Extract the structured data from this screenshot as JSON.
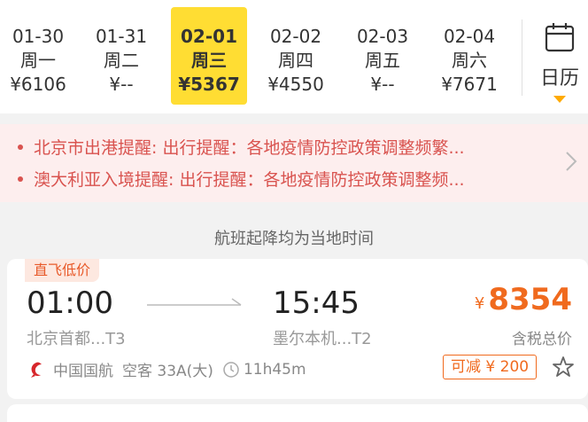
{
  "dates": [
    {
      "date": "01-30",
      "weekday": "周一",
      "price": "¥6106",
      "selected": false
    },
    {
      "date": "01-31",
      "weekday": "周二",
      "price": "¥--",
      "selected": false
    },
    {
      "date": "02-01",
      "weekday": "周三",
      "price": "¥5367",
      "selected": true
    },
    {
      "date": "02-02",
      "weekday": "周四",
      "price": "¥4550",
      "selected": false
    },
    {
      "date": "02-03",
      "weekday": "周五",
      "price": "¥--",
      "selected": false
    },
    {
      "date": "02-04",
      "weekday": "周六",
      "price": "¥7671",
      "selected": false
    }
  ],
  "calendar": {
    "label": "日历",
    "icon": "calendar-icon"
  },
  "notices": [
    {
      "text": "北京市出港提醒: 出行提醒：各地疫情防控政策调整频繁..."
    },
    {
      "text": "澳大利亚入境提醒: 出行提醒：各地疫情防控政策调整频..."
    }
  ],
  "timezone_note": "航班起降均为当地时间",
  "flight": {
    "tag": "直飞低价",
    "dep_time": "01:00",
    "arr_time": "15:45",
    "dep_airport": "北京首都...T3",
    "arr_airport": "墨尔本机...T2",
    "currency": "¥",
    "price": "8354",
    "price_note": "含税总价",
    "airline": "中国国航",
    "aircraft": "空客 33A(大)",
    "duration": "11h45m",
    "discount": "可减 ¥ 200"
  },
  "colors": {
    "accent": "#ffdd33",
    "price": "#f06a1e",
    "notice": "#d9534f",
    "notice_bg": "#fdeeee",
    "airline_logo": "#d7262b"
  }
}
